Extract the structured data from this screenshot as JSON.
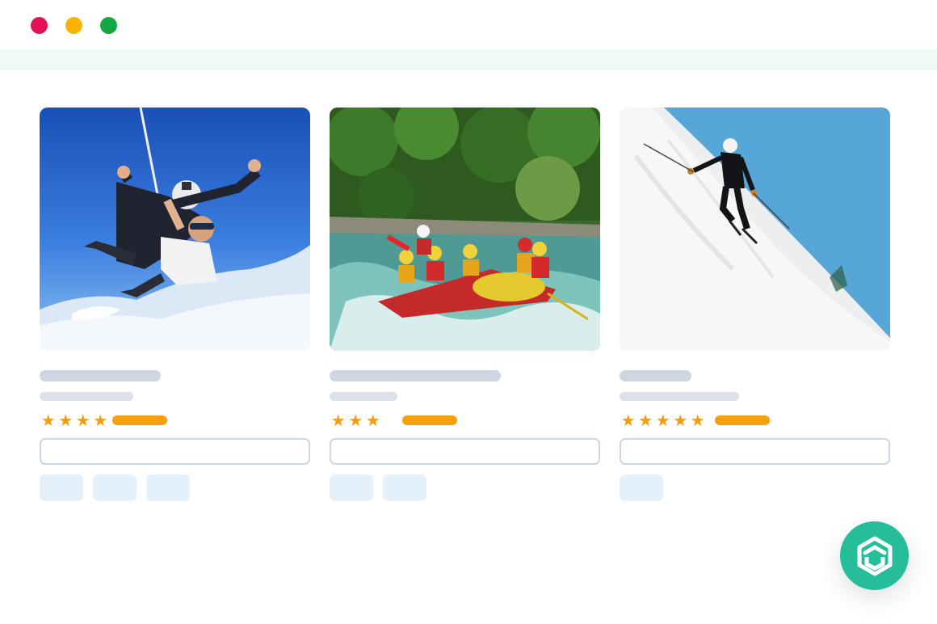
{
  "window": {
    "controls": [
      {
        "name": "close",
        "color": "#e3105a"
      },
      {
        "name": "minimize",
        "color": "#fbb400"
      },
      {
        "name": "maximize",
        "color": "#14a844"
      }
    ]
  },
  "colors": {
    "accent": "#26bd9a",
    "star": "#f39c12",
    "rating_bar": "#f59f0a",
    "placeholder": "#cfd6e1",
    "chip": "#e4f1fb",
    "topbar": "#eefaf5"
  },
  "cards": [
    {
      "activity": "skydiving",
      "image": "skydiving-photo",
      "stars": 4,
      "star_glyph": "★",
      "chip_count": 3
    },
    {
      "activity": "rafting",
      "image": "rafting-photo",
      "stars": 3,
      "star_glyph": "★",
      "chip_count": 2
    },
    {
      "activity": "skiing",
      "image": "skiing-photo",
      "stars": 5,
      "star_glyph": "★",
      "chip_count": 1
    }
  ],
  "fab": {
    "icon": "hexagon-box-icon"
  }
}
